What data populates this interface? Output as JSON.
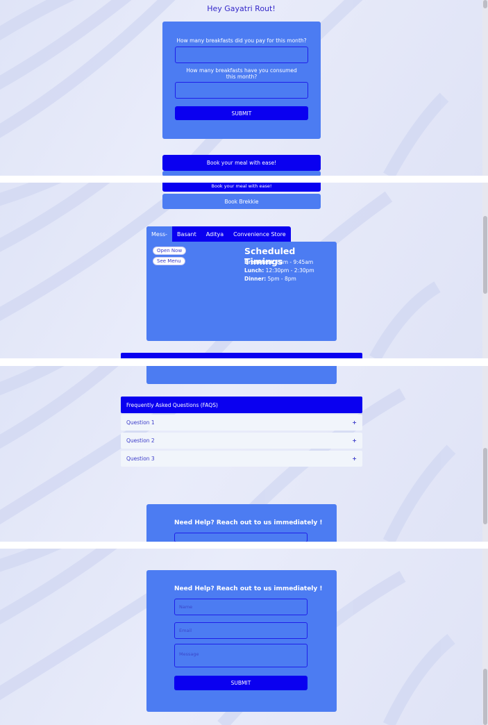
{
  "greeting": "Hey Gayatri Rout!",
  "breakfast_form": {
    "paid_question": "How many breakfasts did you pay for this month?",
    "consumed_question": "How many breakfasts have you consumed this month?",
    "submit_label": "SUBMIT"
  },
  "book_meal_label": "Book your meal with ease!",
  "book_brekkie_label": "Book Brekkie",
  "mess_tabs": [
    "Mess-",
    "Basant",
    "Aditya",
    "Convenience Store"
  ],
  "mess_panel": {
    "open_now_label": "Open Now",
    "see_menu_label": "See Menu",
    "timings_title": "Scheduled Timings",
    "timings": [
      {
        "meal": "Breakfast:",
        "time": "8am - 9:45am"
      },
      {
        "meal": "Lunch:",
        "time": "12:30pm - 2:30pm"
      },
      {
        "meal": "Dinner:",
        "time": "5pm - 8pm"
      }
    ]
  },
  "faq": {
    "title": "Frequently Asked Questions (FAQS)",
    "items": [
      "Question 1",
      "Question 2",
      "Question 3"
    ],
    "expand_icon": "plus-icon"
  },
  "help_form": {
    "title": "Need Help? Reach out to us immediately !",
    "name_placeholder": "Name",
    "email_placeholder": "Email",
    "message_placeholder": "Message",
    "submit_label": "SUBMIT"
  },
  "colors": {
    "accent_dark": "#0a00f0",
    "card_blue": "#4c7cf2",
    "greeting_text": "#3327c9",
    "faq_item_bg": "#f1f5fb"
  }
}
